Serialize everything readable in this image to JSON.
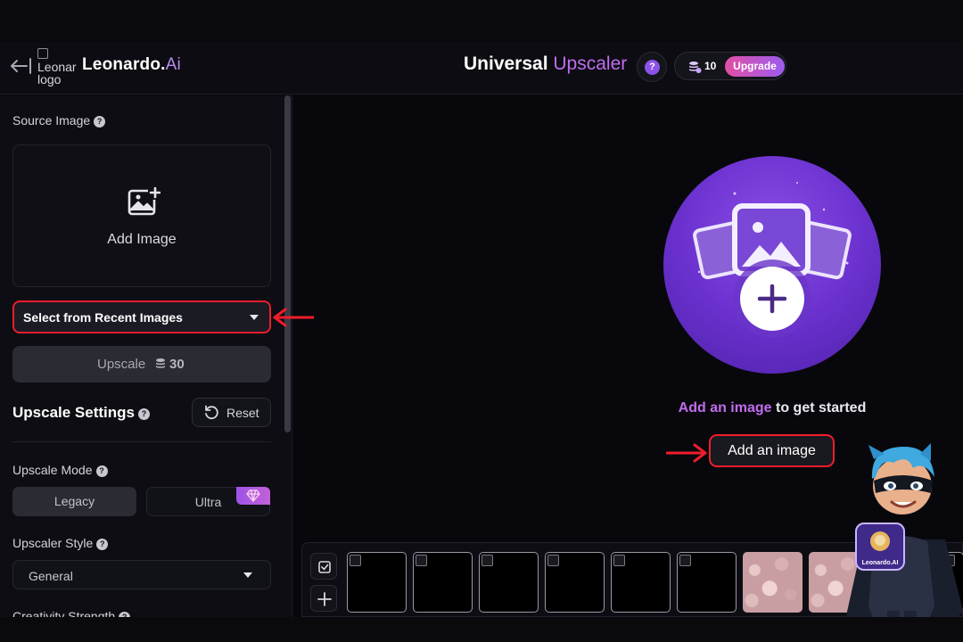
{
  "header": {
    "brand_name": "Leonardo.",
    "brand_suffix": "Ai",
    "logo_alt": "Leonardo logo",
    "title_main": "Universal ",
    "title_accent": "Upscaler",
    "help": "?",
    "tokens": "10",
    "upgrade_label": "Upgrade"
  },
  "sidebar": {
    "source_image_label": "Source Image",
    "add_image_label": "Add Image",
    "recent_select_label": "Select from Recent Images",
    "upscale_button_label": "Upscale",
    "upscale_cost": "30",
    "settings_title": "Upscale Settings",
    "reset_label": "Reset",
    "mode_label": "Upscale Mode",
    "mode_options": [
      "Legacy",
      "Ultra"
    ],
    "mode_selected": "Legacy",
    "style_label": "Upscaler Style",
    "style_value": "General",
    "creativity_label": "Creativity Strength"
  },
  "main": {
    "cta_highlight": "Add an image",
    "cta_rest": " to get started",
    "add_button_label": "Add an image"
  },
  "mascot": {
    "badge_text": "Leonardo.AI"
  },
  "colors": {
    "accent_purple": "#8b52e8",
    "highlight_pink": "#c36cf0",
    "annotation_red": "#ef1d2b",
    "background": "#08080c",
    "panel": "#0d0d13"
  }
}
